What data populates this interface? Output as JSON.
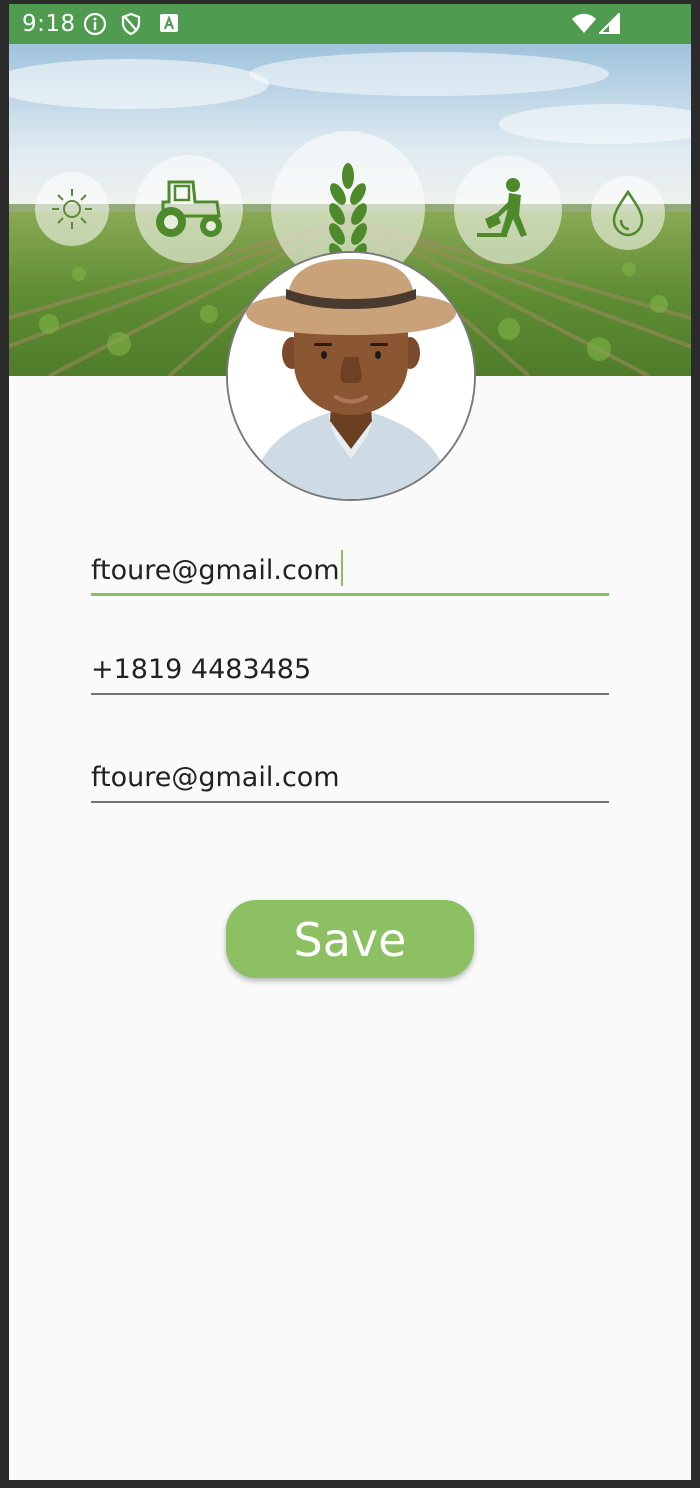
{
  "status_bar": {
    "time": "9:18",
    "icons": [
      "info-icon",
      "shield-icon",
      "a-badge-icon",
      "wifi-icon",
      "signal-icon"
    ],
    "color": "#4f9b4f"
  },
  "header": {
    "icons": [
      "sun-icon",
      "tractor-icon",
      "wheat-icon",
      "farmer-digging-icon",
      "water-drop-icon"
    ]
  },
  "profile": {
    "avatar": "farmer-avatar"
  },
  "form": {
    "email_field": {
      "value": "ftoure@gmail.com",
      "focused": true
    },
    "phone_field": {
      "value": "+1819 4483485"
    },
    "email_confirm_field": {
      "value": "ftoure@gmail.com"
    },
    "save_label": "Save"
  },
  "colors": {
    "accent": "#8cc063",
    "icon_green": "#4e8a2c",
    "background": "#fafafa"
  }
}
